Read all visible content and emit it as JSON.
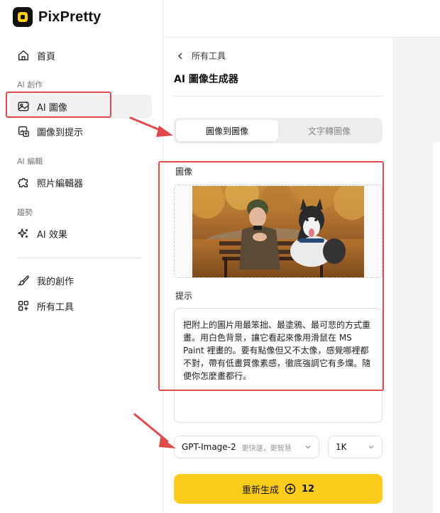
{
  "app": {
    "name": "PixPretty"
  },
  "sidebar": {
    "home": {
      "label": "首頁",
      "icon": "home-icon"
    },
    "sections": {
      "ai_create": "AI 創作",
      "ai_edit": "AI 編輯",
      "trends": "趨勢"
    },
    "items": {
      "ai_image": {
        "label": "AI 圖像",
        "icon": "image-sparkle-icon"
      },
      "image_to_prompt": {
        "label": "圖像到提示",
        "icon": "image-text-icon"
      },
      "photo_editor": {
        "label": "照片編輯器",
        "icon": "puzzle-icon"
      },
      "ai_effects": {
        "label": "AI 效果",
        "icon": "sparkle-icon"
      },
      "my_creations": {
        "label": "我的創作",
        "icon": "brush-icon"
      },
      "all_tools": {
        "label": "所有工具",
        "icon": "grid-icon"
      }
    }
  },
  "main": {
    "back_label": "所有工具",
    "title": "AI 圖像生成器",
    "tabs": [
      {
        "label": "圖像到圖像",
        "active": true
      },
      {
        "label": "文字轉圖像",
        "active": false
      }
    ],
    "image_label": "圖像",
    "prompt_label": "提示",
    "prompt_text": "把附上的圖片用最笨拙、最塗鴉、最可悲的方式重畫。用白色背景，讓它看起來像用滑鼠在 MS Paint 裡畫的。要有點像但又不太像，感覺哪裡都不對，帶有低畫質像素感，徹底強調它有多爛。隨便你怎麼畫都行。",
    "model": {
      "name": "GPT-Image-2",
      "desc": "更快速，更智慧"
    },
    "resolution": "1K",
    "generate": {
      "label": "重新生成",
      "cost": "12"
    }
  },
  "colors": {
    "accent": "#fccc1c",
    "highlight": "#e04a4a",
    "active_nav_bg": "#f1f1f1"
  }
}
